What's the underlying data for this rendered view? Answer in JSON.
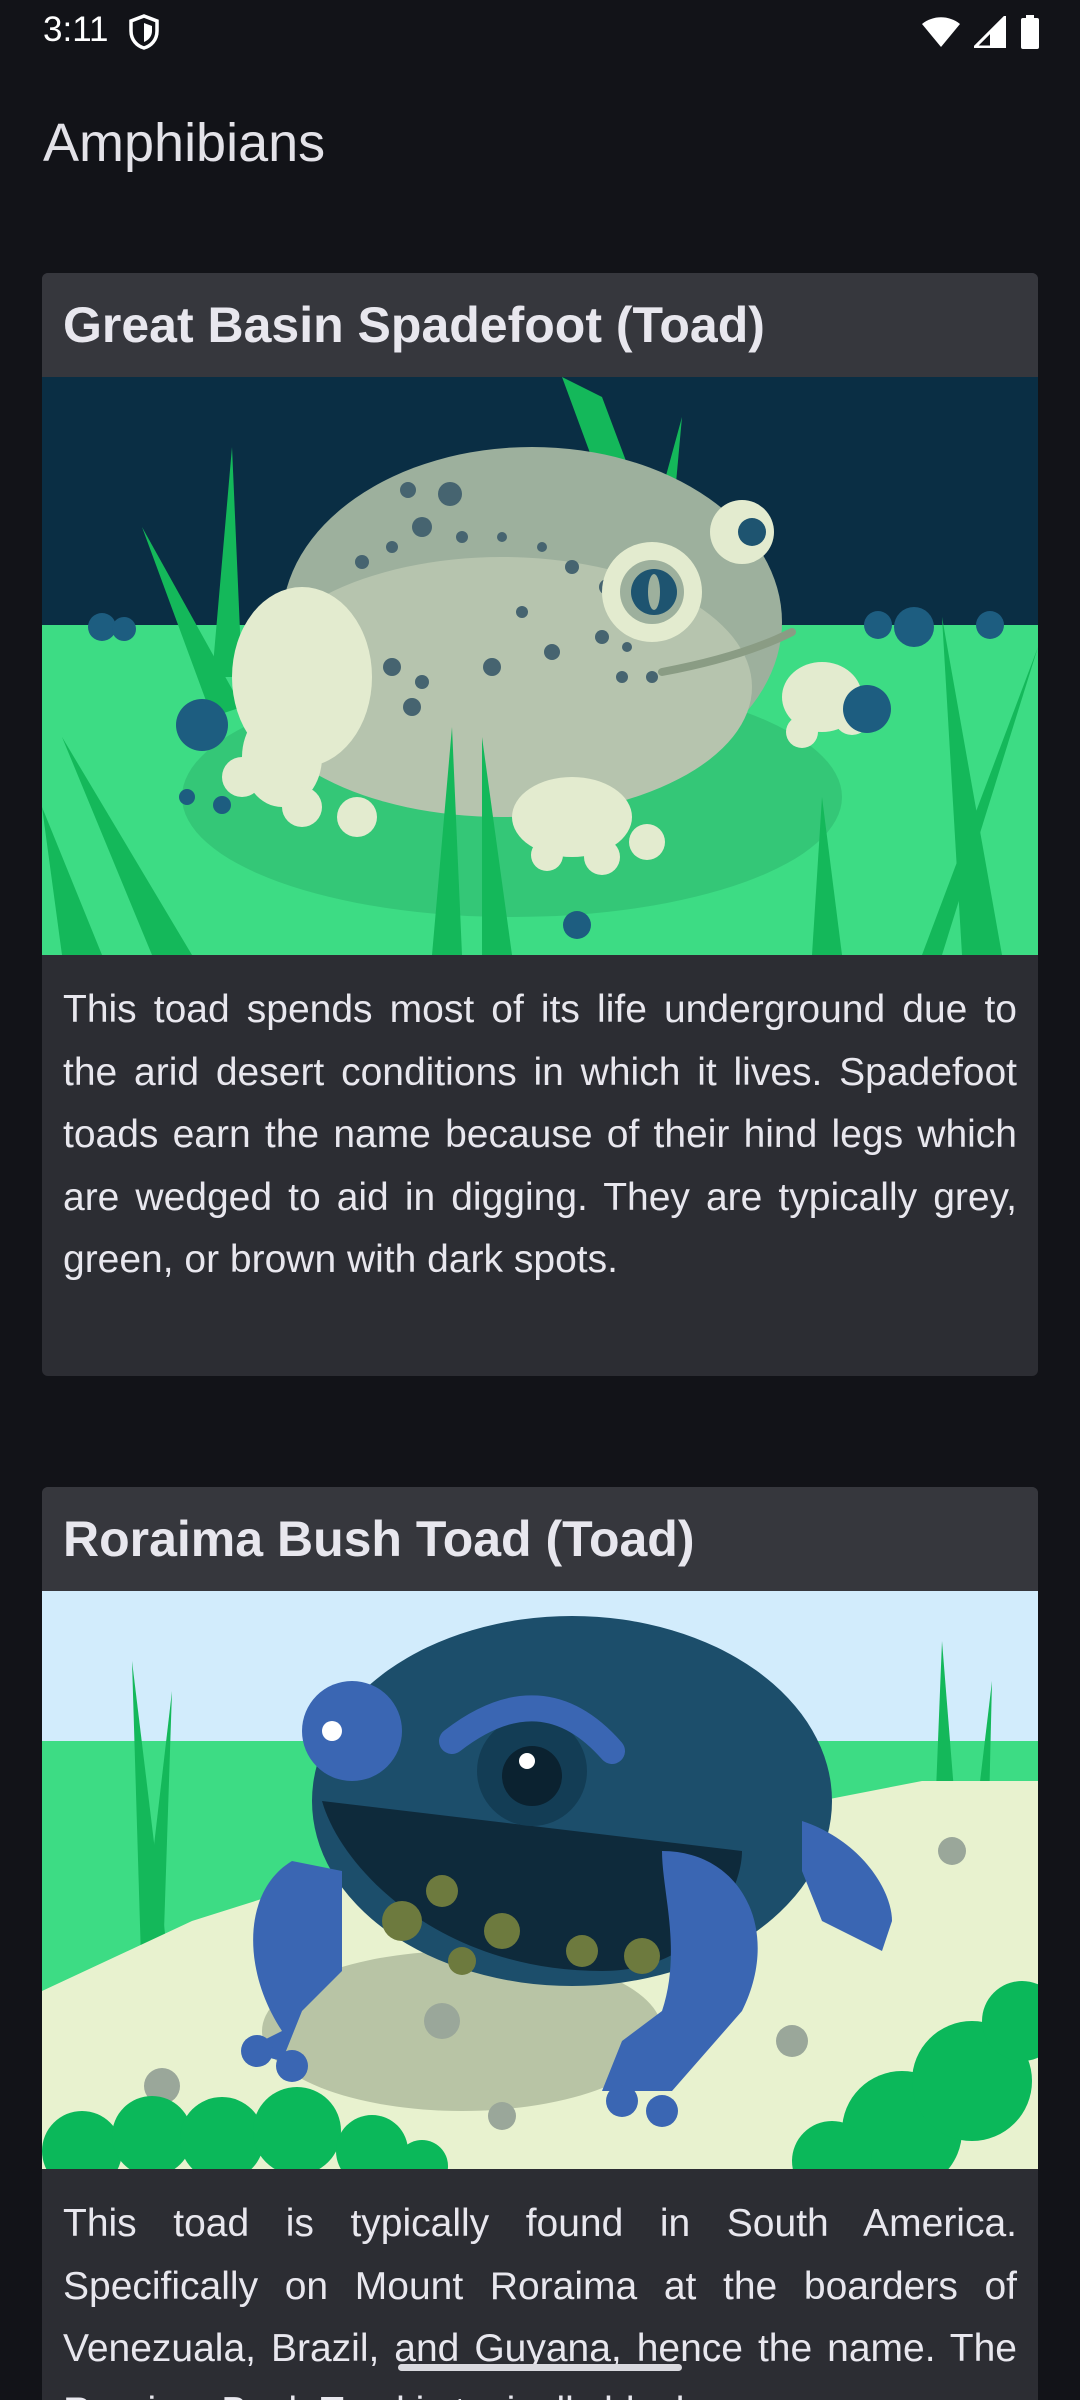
{
  "status_bar": {
    "time": "3:11"
  },
  "app": {
    "title": "Amphibians"
  },
  "cards": [
    {
      "title": "Great Basin Spadefoot (Toad)",
      "image": "great-basin-spadefoot-illustration",
      "description": "This toad spends most of its life underground due to the arid desert conditions in which it lives. Spadefoot toads earn the name because of their hind legs which are wedged to aid in digging. They are typically grey, green, or brown with dark spots."
    },
    {
      "title": "Roraima Bush Toad (Toad)",
      "image": "roraima-bush-toad-illustration",
      "description": "This toad is typically found in South America. Specifically on Mount Roraima at the boarders of Venezuala, Brazil, and Guyana, hence the name. The Roraiam Bush Toad is typically black"
    }
  ],
  "colors": {
    "background": "#121318",
    "card": "#2c2d33",
    "card_header": "#36373d",
    "text": "#e3e2e8"
  }
}
